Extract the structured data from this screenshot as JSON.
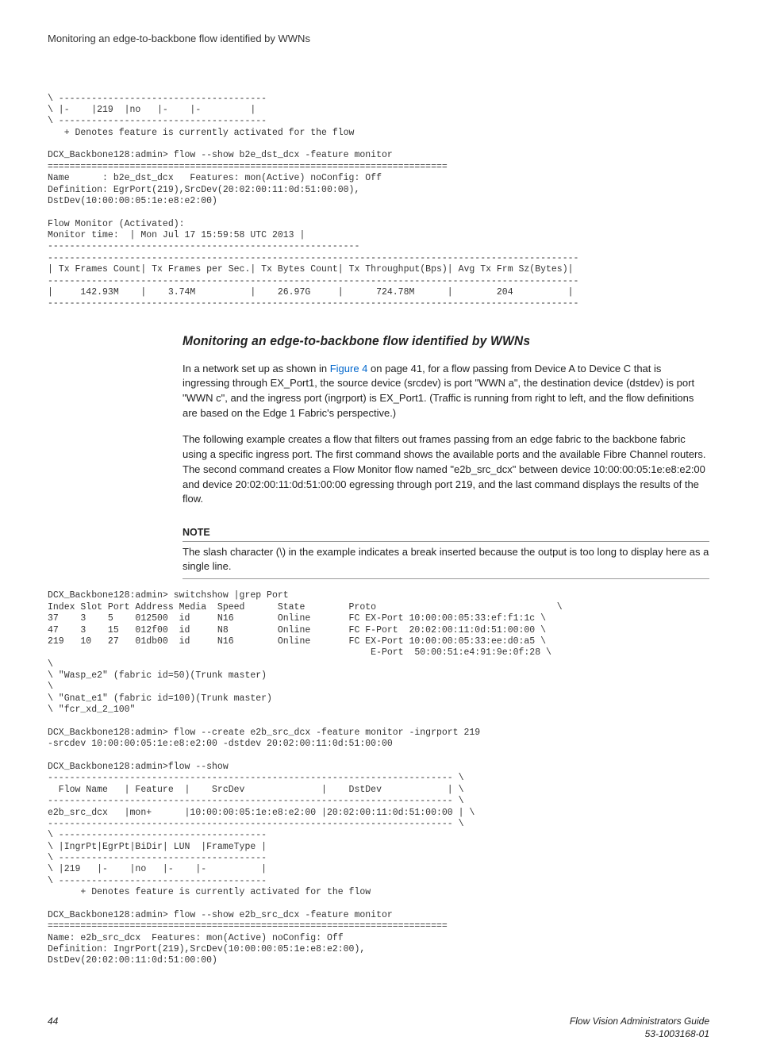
{
  "header": {
    "title": "Monitoring an edge-to-backbone flow identified by WWNs"
  },
  "code_top": "\\ --------------------------------------\n\\ |-    |219  |no   |-    |-         |\n\\ --------------------------------------\n   + Denotes feature is currently activated for the flow\n\nDCX_Backbone128:admin> flow --show b2e_dst_dcx -feature monitor\n=========================================================================\nName      : b2e_dst_dcx   Features: mon(Active) noConfig: Off\nDefinition: EgrPort(219),SrcDev(20:02:00:11:0d:51:00:00),\nDstDev(10:00:00:05:1e:e8:e2:00)\n\nFlow Monitor (Activated):\nMonitor time:  | Mon Jul 17 15:59:58 UTC 2013 |\n---------------------------------------------------------\n-------------------------------------------------------------------------------------------------\n| Tx Frames Count| Tx Frames per Sec.| Tx Bytes Count| Tx Throughput(Bps)| Avg Tx Frm Sz(Bytes)|\n-------------------------------------------------------------------------------------------------\n|     142.93M    |    3.74M          |    26.97G     |      724.78M      |        204          |\n-------------------------------------------------------------------------------------------------",
  "section": {
    "title": "Monitoring an edge-to-backbone flow identified by WWNs",
    "p1_a": "In a network set up as shown in ",
    "p1_link": "Figure 4",
    "p1_b": " on page 41, for a flow passing from Device A to Device C that is ingressing through EX_Port1, the source device (srcdev) is port \"WWN a\", the destination device (dstdev) is port \"WWN c\", and the ingress port (ingrport) is EX_Port1. (Traffic is running from right to left, and the flow definitions are based on the Edge 1 Fabric's perspective.)",
    "p2": "The following example creates a flow that filters out frames passing from an edge fabric to the backbone fabric using a specific ingress port. The first command shows the available ports and the available Fibre Channel routers. The second command creates a Flow Monitor flow named \"e2b_src_dcx\" between device 10:00:00:05:1e:e8:e2:00 and device 20:02:00:11:0d:51:00:00 egressing through port 219, and the last command displays the results of the flow."
  },
  "note": {
    "title": "NOTE",
    "body": "The slash character (\\) in the example indicates a break inserted because the output is too long to display here as a single line."
  },
  "code_bottom": "DCX_Backbone128:admin> switchshow |grep Port\nIndex Slot Port Address Media  Speed      State        Proto                                 \\\n37    3    5    012500  id     N16        Online       FC EX-Port 10:00:00:05:33:ef:f1:1c \\\n47    3    15   012f00  id     N8         Online       FC F-Port  20:02:00:11:0d:51:00:00 \\\n219   10   27   01db00  id     N16        Online       FC EX-Port 10:00:00:05:33:ee:d0:a5 \\\n                                                           E-Port  50:00:51:e4:91:9e:0f:28 \\\n\\\n\\ \"Wasp_e2\" (fabric id=50)(Trunk master)\n\\\n\\ \"Gnat_e1\" (fabric id=100)(Trunk master)\n\\ \"fcr_xd_2_100\"\n\nDCX_Backbone128:admin> flow --create e2b_src_dcx -feature monitor -ingrport 219\n-srcdev 10:00:00:05:1e:e8:e2:00 -dstdev 20:02:00:11:0d:51:00:00\n\nDCX_Backbone128:admin>flow --show\n-------------------------------------------------------------------------- \\\n  Flow Name   | Feature  |    SrcDev              |    DstDev            | \\\n-------------------------------------------------------------------------- \\\ne2b_src_dcx   |mon+      |10:00:00:05:1e:e8:e2:00 |20:02:00:11:0d:51:00:00 | \\\n-------------------------------------------------------------------------- \\\n\\ --------------------------------------\n\\ |IngrPt|EgrPt|BiDir| LUN  |FrameType |\n\\ --------------------------------------\n\\ |219   |-    |no   |-    |-          |\n\\ --------------------------------------\n      + Denotes feature is currently activated for the flow\n\nDCX_Backbone128:admin> flow --show e2b_src_dcx -feature monitor\n=========================================================================\nName: e2b_src_dcx  Features: mon(Active) noConfig: Off\nDefinition: IngrPort(219),SrcDev(10:00:00:05:1e:e8:e2:00),\nDstDev(20:02:00:11:0d:51:00:00)",
  "footer": {
    "page": "44",
    "doc_title": "Flow Vision Administrators Guide",
    "doc_id": "53-1003168-01"
  }
}
